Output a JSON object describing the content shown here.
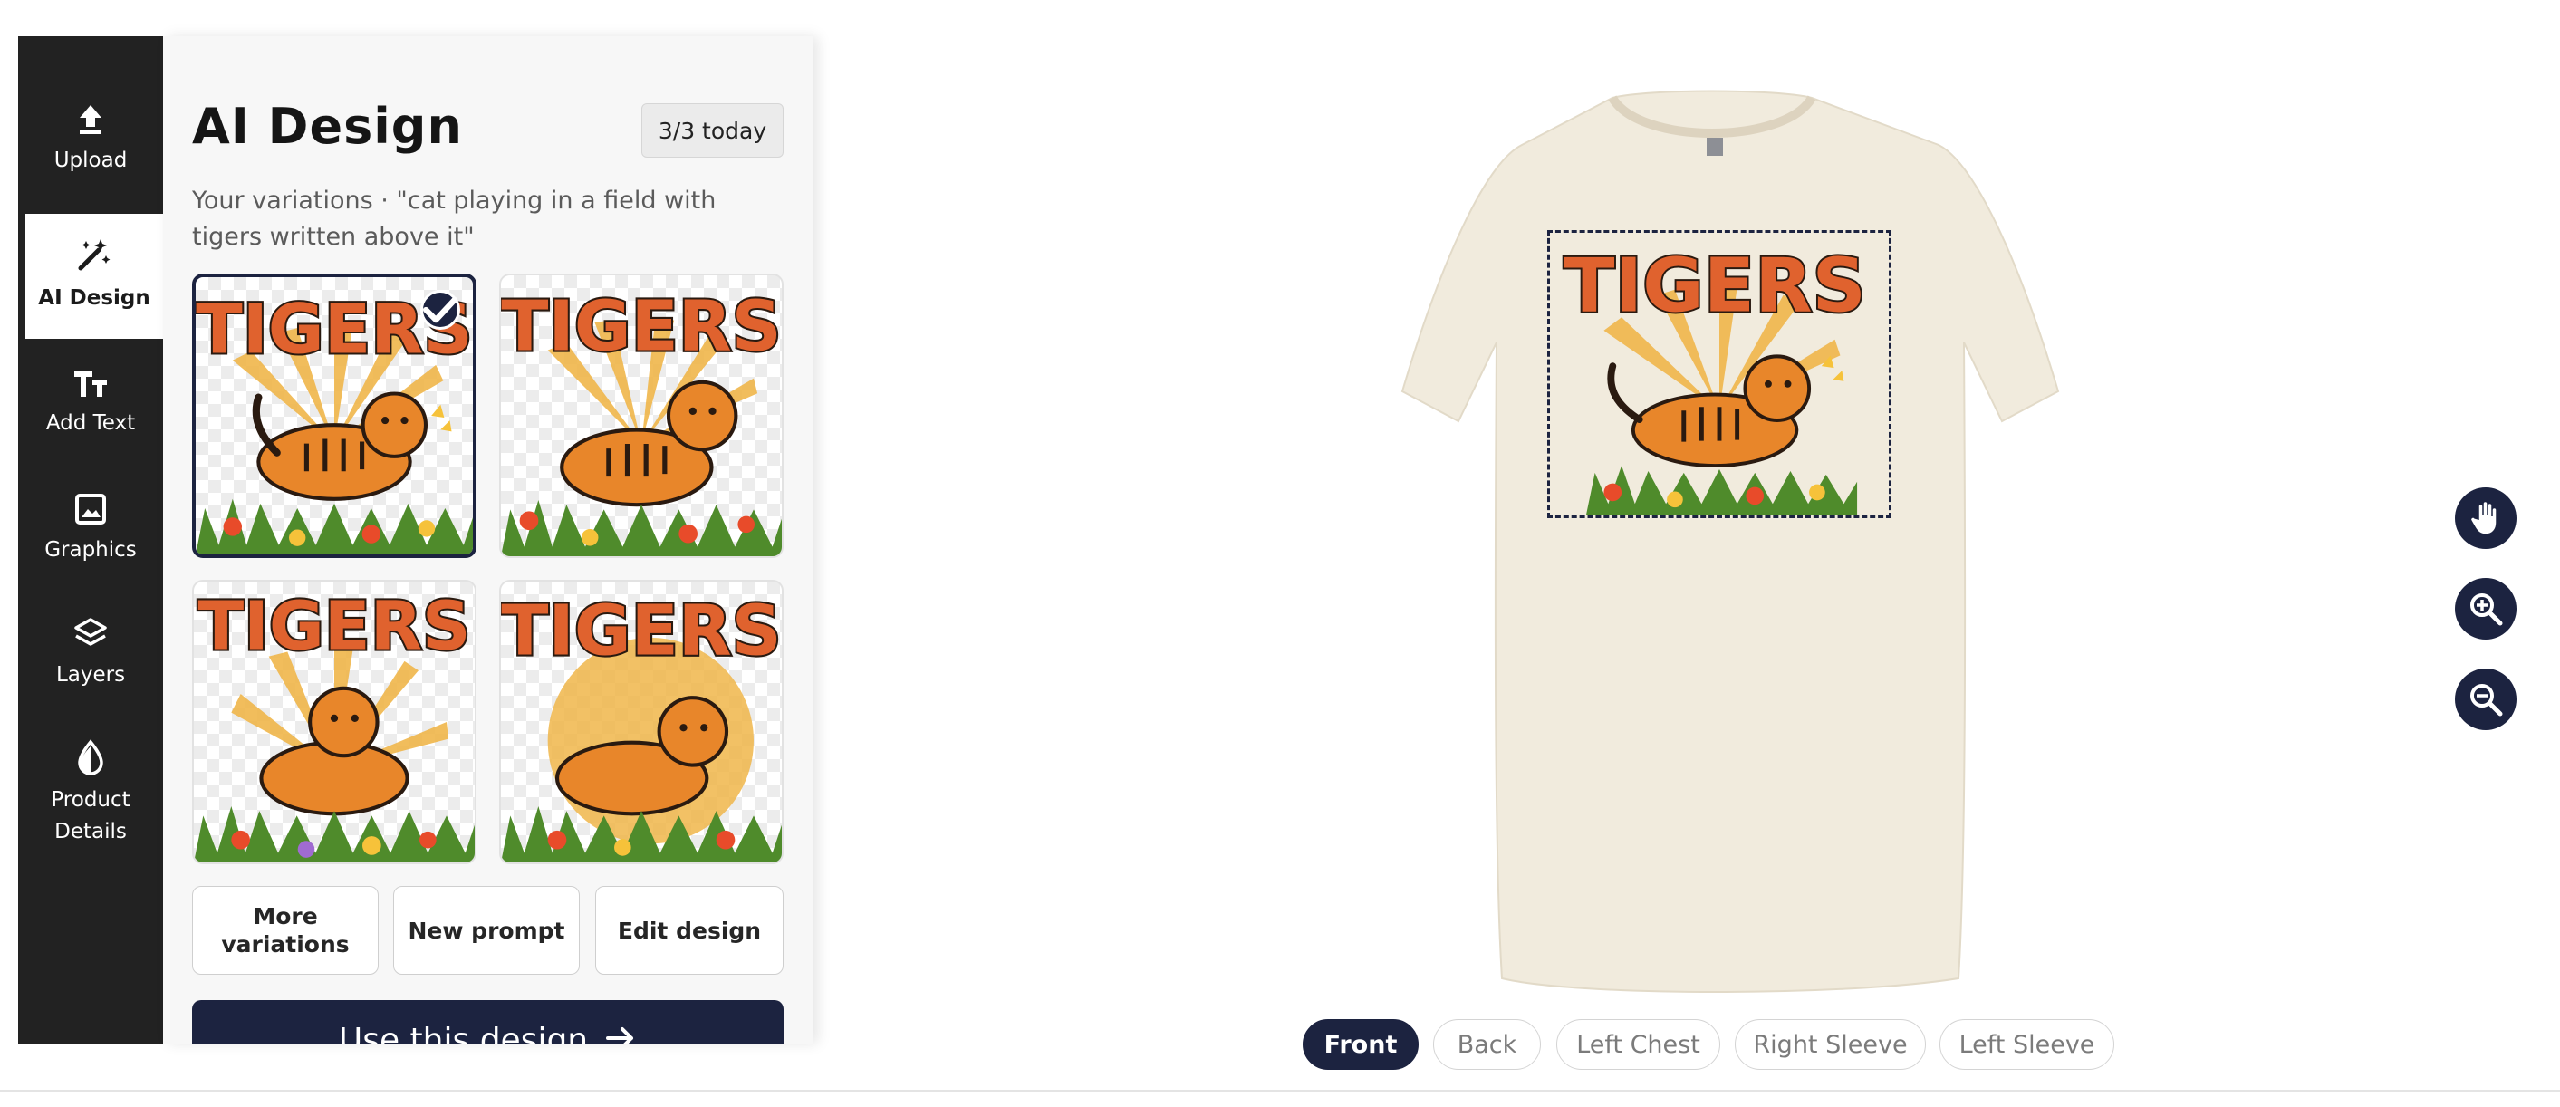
{
  "sidebar": {
    "items": [
      {
        "label": "Upload",
        "icon": "upload-icon"
      },
      {
        "label": "AI Design",
        "icon": "magic-wand-icon",
        "active": true
      },
      {
        "label": "Add Text",
        "icon": "text-icon"
      },
      {
        "label": "Graphics",
        "icon": "image-icon"
      },
      {
        "label": "Layers",
        "icon": "layers-icon"
      },
      {
        "label": "Product\nDetails",
        "icon": "droplet-icon"
      }
    ]
  },
  "panel": {
    "title": "AI Design",
    "quota": "3/3 today",
    "subtitle": "Your variations · \"cat playing in a field with tigers written above it\"",
    "variations": [
      {
        "text": "TIGERS",
        "selected": true
      },
      {
        "text": "TIGERS",
        "selected": false
      },
      {
        "text": "TIGERS",
        "selected": false
      },
      {
        "text": "TIGERS",
        "selected": false
      }
    ],
    "actions": {
      "more_variations": "More variations",
      "new_prompt": "New prompt",
      "edit_design": "Edit design"
    },
    "primary_cta": "Use this design"
  },
  "canvas": {
    "design_text": "TIGERS",
    "tools": [
      "hand-icon",
      "zoom-in-icon",
      "zoom-out-icon"
    ],
    "view_tabs": [
      {
        "label": "Front",
        "active": true
      },
      {
        "label": "Back",
        "active": false
      },
      {
        "label": "Left Chest",
        "active": false
      },
      {
        "label": "Right Sleeve",
        "active": false
      },
      {
        "label": "Left Sleeve",
        "active": false
      }
    ]
  },
  "colors": {
    "navy": "#1c2340",
    "rail": "#222222",
    "shirt": "#f1ebdd",
    "tiger_orange": "#e8862a",
    "title_orange": "#e0622e"
  }
}
